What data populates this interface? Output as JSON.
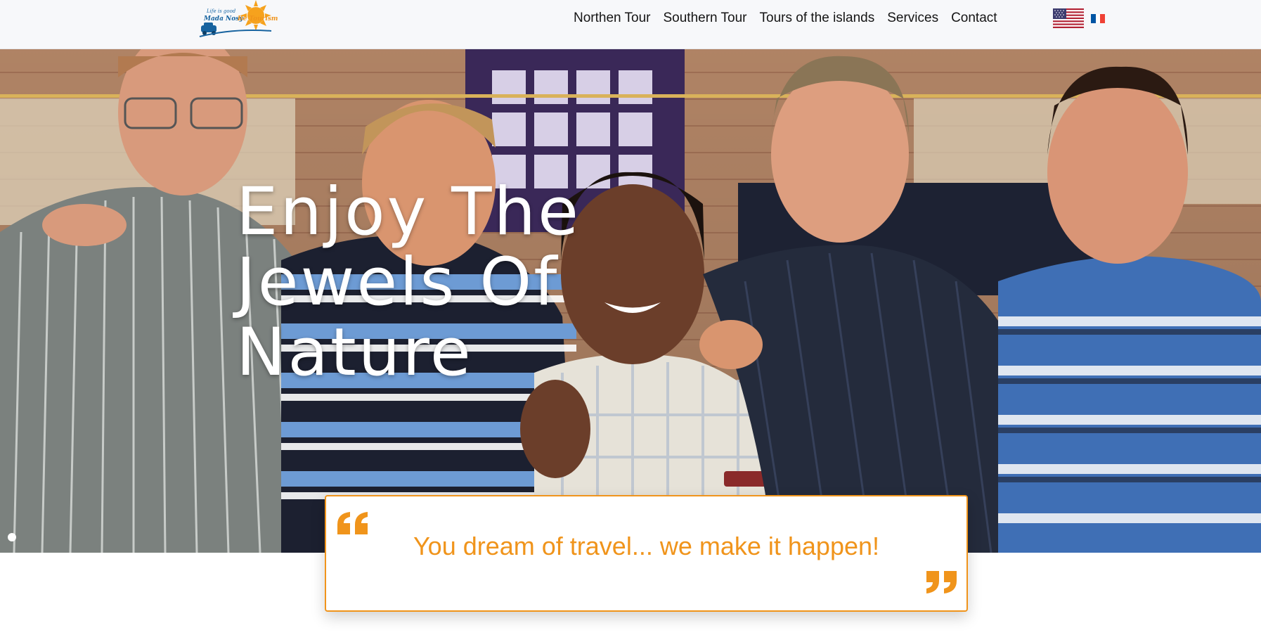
{
  "header": {
    "logo": {
      "tagline": "Life is good",
      "brand_part1": "Mada Nosy",
      "brand_part2": "Be Tourism"
    },
    "nav": [
      {
        "label": "Northen Tour"
      },
      {
        "label": "Southern Tour"
      },
      {
        "label": "Tours of the islands"
      },
      {
        "label": "Services"
      },
      {
        "label": "Contact"
      }
    ],
    "languages": [
      {
        "icon": "us-flag-icon"
      },
      {
        "icon": "fr-flag-icon"
      }
    ]
  },
  "hero": {
    "headline_lines": [
      "Enjoy The",
      "Jewels Of",
      "Nature"
    ],
    "slide_dots": 1,
    "active_slide": 1
  },
  "quote": {
    "text": "You dream of travel... we make it happen!",
    "icons": [
      "quote-open-icon",
      "quote-close-icon"
    ]
  },
  "colors": {
    "accent": "#f0941b",
    "header_bg": "#f7f8fa",
    "nav_text": "#151515",
    "brand_blue": "#17639f"
  }
}
